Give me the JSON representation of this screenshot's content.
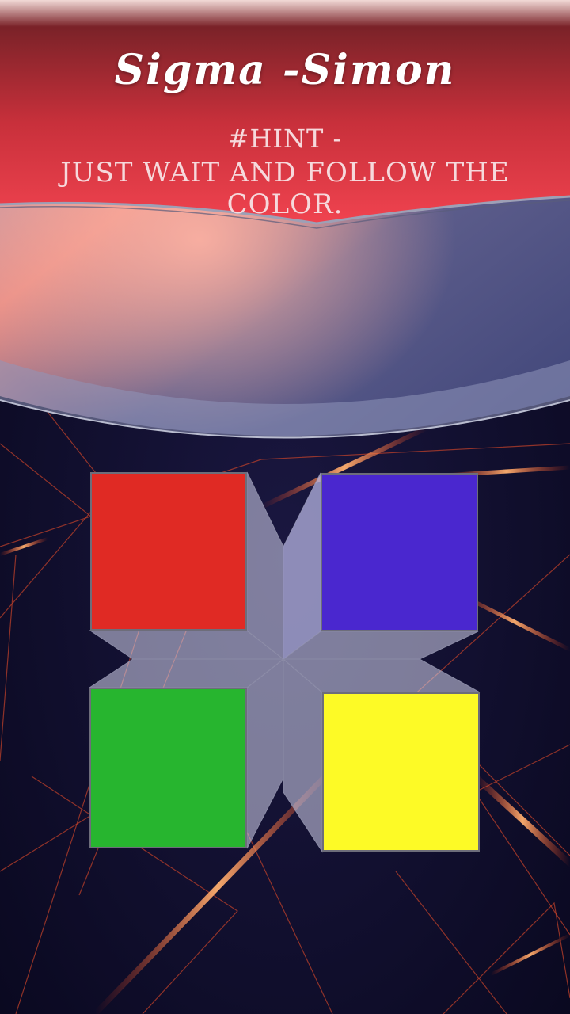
{
  "game": {
    "title": "Sigma -Simon",
    "hint_heading": "#HINT -",
    "hint_text": "Just wait and follow the color."
  },
  "pads": [
    {
      "name": "red",
      "color": "#e02a24"
    },
    {
      "name": "blue",
      "color": "#4a27cf"
    },
    {
      "name": "green",
      "color": "#27b52f"
    },
    {
      "name": "yellow",
      "color": "#fdfa26"
    }
  ],
  "theme": {
    "header_red": "#d4313f",
    "background_dark": "#0b0a22",
    "streak_orange": "#ff5a1c",
    "glass_tint": "#c9c9e6"
  }
}
